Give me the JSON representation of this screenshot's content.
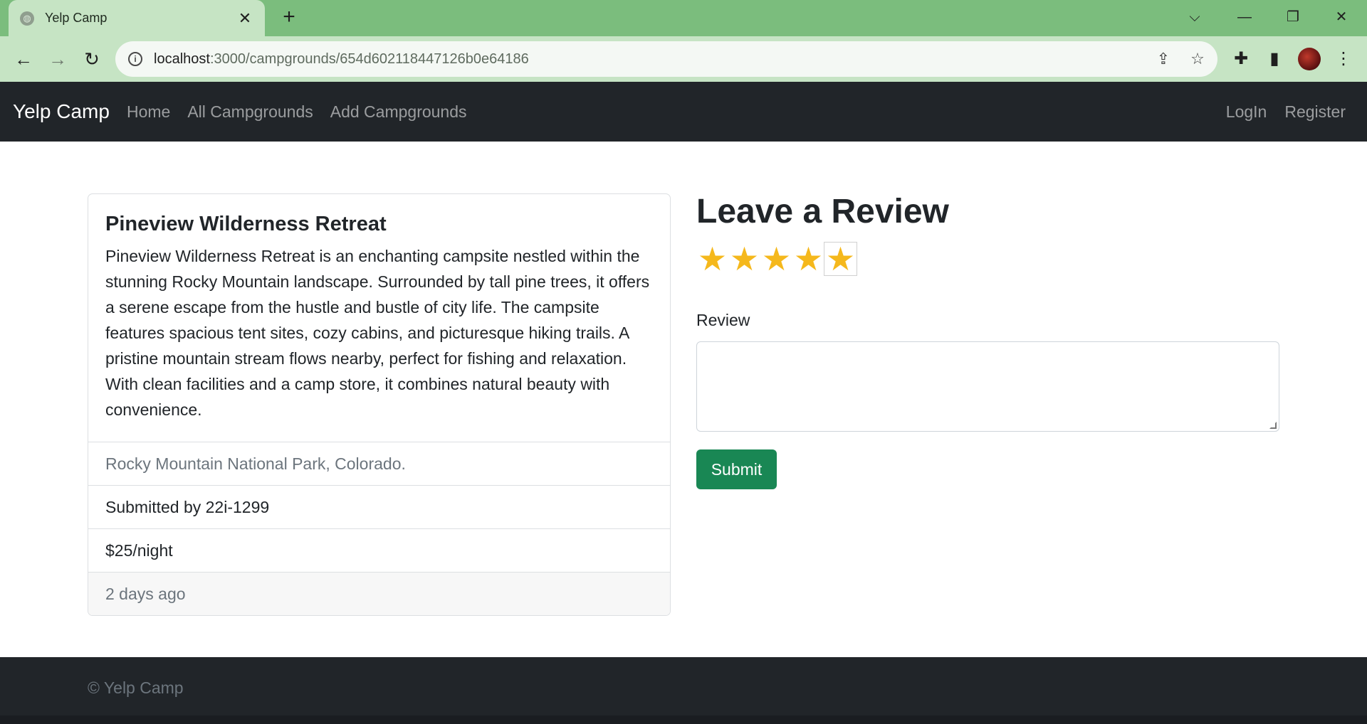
{
  "browser": {
    "tab_title": "Yelp Camp",
    "tab_close": "✕",
    "new_tab": "+",
    "url_host": "localhost",
    "url_path": ":3000/campgrounds/654d602118447126b0e64186",
    "win_dropdown": "⌵",
    "win_minimize": "—",
    "win_restore": "❐",
    "win_close": "✕"
  },
  "navbar": {
    "brand": "Yelp Camp",
    "links": [
      "Home",
      "All Campgrounds",
      "Add Campgrounds"
    ],
    "right_links": [
      "LogIn",
      "Register"
    ]
  },
  "campground": {
    "title": "Pineview Wilderness Retreat",
    "description": "Pineview Wilderness Retreat is an enchanting campsite nestled within the stunning Rocky Mountain landscape. Surrounded by tall pine trees, it offers a serene escape from the hustle and bustle of city life. The campsite features spacious tent sites, cozy cabins, and picturesque hiking trails. A pristine mountain stream flows nearby, perfect for fishing and relaxation. With clean facilities and a camp store, it combines natural beauty with convenience.",
    "location": "Rocky Mountain National Park, Colorado.",
    "submitted_by": "Submitted by 22i-1299",
    "price": "$25/night",
    "time_ago": "2 days ago"
  },
  "review": {
    "heading": "Leave a Review",
    "rating": 5,
    "rating_max": 5,
    "star_glyph": "★",
    "label": "Review",
    "textarea_value": "",
    "submit_label": "Submit"
  },
  "footer": {
    "text": "© Yelp Camp"
  },
  "colors": {
    "tabstrip": "#7bbd7d",
    "toolbar": "#c6e4c4",
    "navbar": "#212529",
    "star": "#f5b81c",
    "submit": "#198754"
  }
}
